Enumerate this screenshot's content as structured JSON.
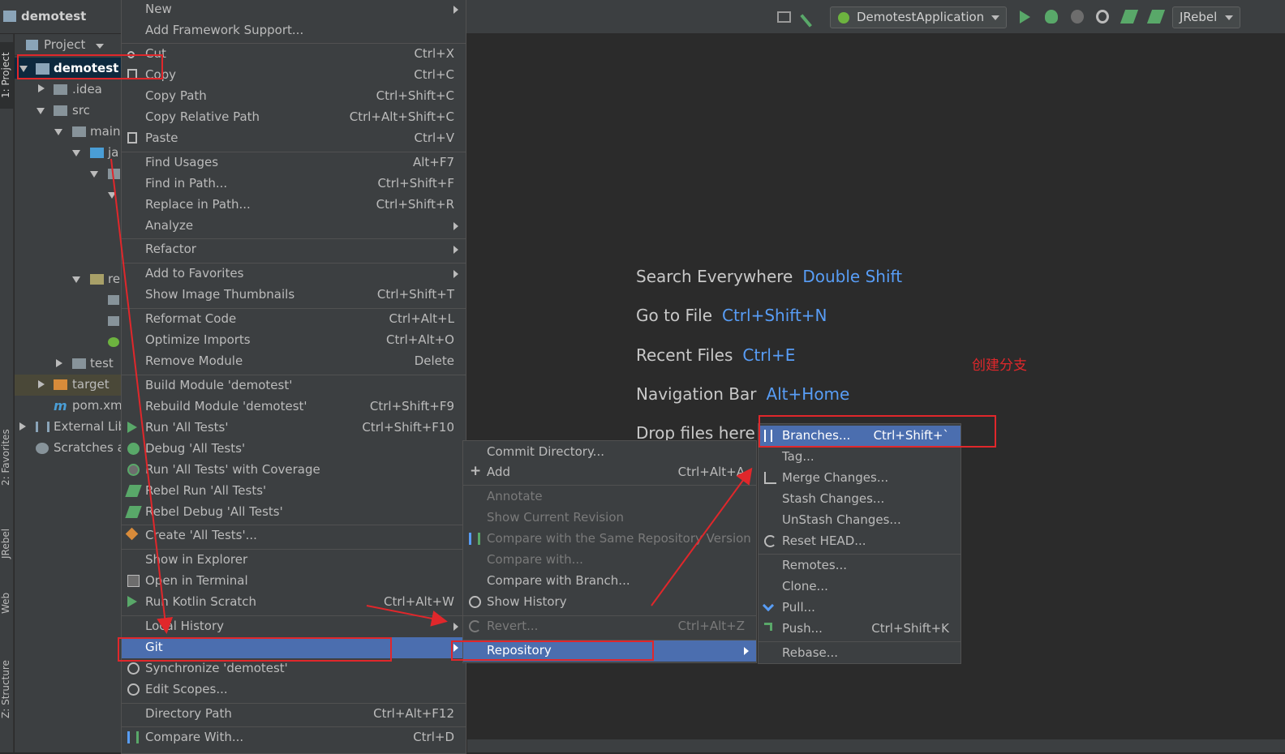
{
  "titlebar": {
    "project_name": "demotest",
    "run_config": "DemotestApplication",
    "jrebel": "JRebel"
  },
  "left_tabs": [
    "1: Project",
    "2: Favorites",
    "JRebel",
    "Web",
    "Z: Structure"
  ],
  "project_panel": {
    "header": "Project",
    "tree": [
      "demotest",
      ".idea",
      "src",
      "main",
      "ja",
      "re",
      "test",
      "target",
      "pom.xm",
      "External Lib",
      "Scratches a"
    ]
  },
  "editor_hints": [
    {
      "label": "Search Everywhere",
      "key": "Double Shift"
    },
    {
      "label": "Go to File",
      "key": "Ctrl+Shift+N"
    },
    {
      "label": "Recent Files",
      "key": "Ctrl+E"
    },
    {
      "label": "Navigation Bar",
      "key": "Alt+Home"
    },
    {
      "label": "Drop files here t",
      "key": ""
    }
  ],
  "annotation": "创建分支",
  "context_menu": [
    {
      "label": "New",
      "shortcut": "",
      "sub": true
    },
    {
      "label": "Add Framework Support...",
      "shortcut": ""
    },
    {
      "label": "Cut",
      "shortcut": "Ctrl+X",
      "icon": "scissors-icon"
    },
    {
      "label": "Copy",
      "shortcut": "Ctrl+C",
      "icon": "copy-icon"
    },
    {
      "label": "Copy Path",
      "shortcut": "Ctrl+Shift+C"
    },
    {
      "label": "Copy Relative Path",
      "shortcut": "Ctrl+Alt+Shift+C"
    },
    {
      "label": "Paste",
      "shortcut": "Ctrl+V",
      "icon": "paste-icon"
    },
    {
      "label": "Find Usages",
      "shortcut": "Alt+F7"
    },
    {
      "label": "Find in Path...",
      "shortcut": "Ctrl+Shift+F"
    },
    {
      "label": "Replace in Path...",
      "shortcut": "Ctrl+Shift+R"
    },
    {
      "label": "Analyze",
      "shortcut": "",
      "sub": true
    },
    {
      "label": "Refactor",
      "shortcut": "",
      "sub": true
    },
    {
      "label": "Add to Favorites",
      "shortcut": "",
      "sub": true
    },
    {
      "label": "Show Image Thumbnails",
      "shortcut": "Ctrl+Shift+T"
    },
    {
      "label": "Reformat Code",
      "shortcut": "Ctrl+Alt+L"
    },
    {
      "label": "Optimize Imports",
      "shortcut": "Ctrl+Alt+O"
    },
    {
      "label": "Remove Module",
      "shortcut": "Delete"
    },
    {
      "label": "Build Module 'demotest'",
      "shortcut": ""
    },
    {
      "label": "Rebuild Module 'demotest'",
      "shortcut": "Ctrl+Shift+F9"
    },
    {
      "label": "Run 'All Tests'",
      "shortcut": "Ctrl+Shift+F10",
      "icon": "run-icon"
    },
    {
      "label": "Debug 'All Tests'",
      "shortcut": "",
      "icon": "debug-icon"
    },
    {
      "label": "Run 'All Tests' with Coverage",
      "shortcut": "",
      "icon": "coverage-icon"
    },
    {
      "label": "Rebel Run 'All Tests'",
      "shortcut": "",
      "icon": "rebel-run-icon"
    },
    {
      "label": "Rebel Debug 'All Tests'",
      "shortcut": "",
      "icon": "rebel-debug-icon"
    },
    {
      "label": "Create 'All Tests'...",
      "shortcut": "",
      "icon": "create-config-icon"
    },
    {
      "label": "Show in Explorer",
      "shortcut": ""
    },
    {
      "label": "Open in Terminal",
      "shortcut": "",
      "icon": "terminal-icon"
    },
    {
      "label": "Run Kotlin Scratch",
      "shortcut": "Ctrl+Alt+W",
      "icon": "run-icon"
    },
    {
      "label": "Local History",
      "shortcut": "",
      "sub": true
    },
    {
      "label": "Git",
      "shortcut": "",
      "sub": true
    },
    {
      "label": "Synchronize 'demotest'",
      "shortcut": "",
      "icon": "sync-icon"
    },
    {
      "label": "Edit Scopes...",
      "shortcut": "",
      "icon": "scope-icon"
    },
    {
      "label": "Directory Path",
      "shortcut": "Ctrl+Alt+F12"
    },
    {
      "label": "Compare With...",
      "shortcut": "Ctrl+D",
      "icon": "compare-icon"
    }
  ],
  "git_menu": [
    {
      "label": "Commit Directory...",
      "shortcut": ""
    },
    {
      "label": "Add",
      "shortcut": "Ctrl+Alt+A",
      "icon": "plus-icon"
    },
    {
      "label": "Annotate",
      "shortcut": "",
      "disabled": true
    },
    {
      "label": "Show Current Revision",
      "shortcut": "",
      "disabled": true
    },
    {
      "label": "Compare with the Same Repository Version",
      "shortcut": "",
      "disabled": true,
      "icon": "compare-icon"
    },
    {
      "label": "Compare with...",
      "shortcut": "",
      "disabled": true
    },
    {
      "label": "Compare with Branch...",
      "shortcut": ""
    },
    {
      "label": "Show History",
      "shortcut": "",
      "icon": "clock-icon"
    },
    {
      "label": "Revert...",
      "shortcut": "Ctrl+Alt+Z",
      "disabled": true,
      "icon": "revert-icon"
    },
    {
      "label": "Repository",
      "shortcut": "",
      "sub": true
    }
  ],
  "repo_menu": [
    {
      "label": "Branches...",
      "shortcut": "Ctrl+Shift+`",
      "icon": "branch-icon"
    },
    {
      "label": "Tag...",
      "shortcut": ""
    },
    {
      "label": "Merge Changes...",
      "shortcut": "",
      "icon": "merge-icon"
    },
    {
      "label": "Stash Changes...",
      "shortcut": ""
    },
    {
      "label": "UnStash Changes...",
      "shortcut": ""
    },
    {
      "label": "Reset HEAD...",
      "shortcut": "",
      "icon": "reset-icon"
    },
    {
      "label": "Remotes...",
      "shortcut": ""
    },
    {
      "label": "Clone...",
      "shortcut": ""
    },
    {
      "label": "Pull...",
      "shortcut": "",
      "icon": "pull-icon"
    },
    {
      "label": "Push...",
      "shortcut": "Ctrl+Shift+K",
      "icon": "push-icon"
    },
    {
      "label": "Rebase...",
      "shortcut": ""
    }
  ],
  "colors": {
    "selection": "#4b6eaf",
    "annotation_red": "#e0272b",
    "link_blue": "#589df6"
  }
}
